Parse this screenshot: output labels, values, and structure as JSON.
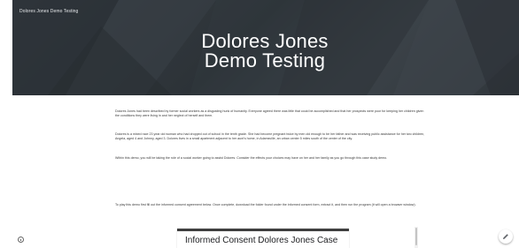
{
  "site": {
    "name": "Dolores Jones Demo Testing"
  },
  "hero": {
    "title_line1": "Dolores Jones",
    "title_line2": "Demo Testing"
  },
  "paragraphs": [
    "Dolores Jones had been described by former social workers as a disgusting hunk of humanity. Everyone agreed there was little that could be accomplished and that her prospects were poor for keeping her children given the conditions they were living in and her neglect of herself and them.",
    "Dolores is a mixed race 23 year old woman who had dropped out of school in the tenth grade. She had become pregnant twice by men old enough to be her father and was receiving public assistance for her two children, Angela, aged 4 and Johnny, aged 3. Dolores lives in a small apartment adjacent to her aunt's home, in Adamsville, an urban center 5 miles south of the center of the city.",
    "Within this demo, you will be taking the role of a social worker going to assist Dolores. Consider the effects your choices may have on her and her family as you go through this case study demo.",
    "To play this demo first fill out the informed consent agreement below. Once complete, download the folder found under the informed consent form, extract it, and then run the program (it will open a browser window)."
  ],
  "embed": {
    "title": "Informed Consent Dolores Jones Case"
  },
  "icons": {
    "info": "info-icon",
    "edit": "pencil-icon"
  },
  "colors": {
    "hero_bg": "#32383d",
    "text": "#3a3a3a"
  }
}
